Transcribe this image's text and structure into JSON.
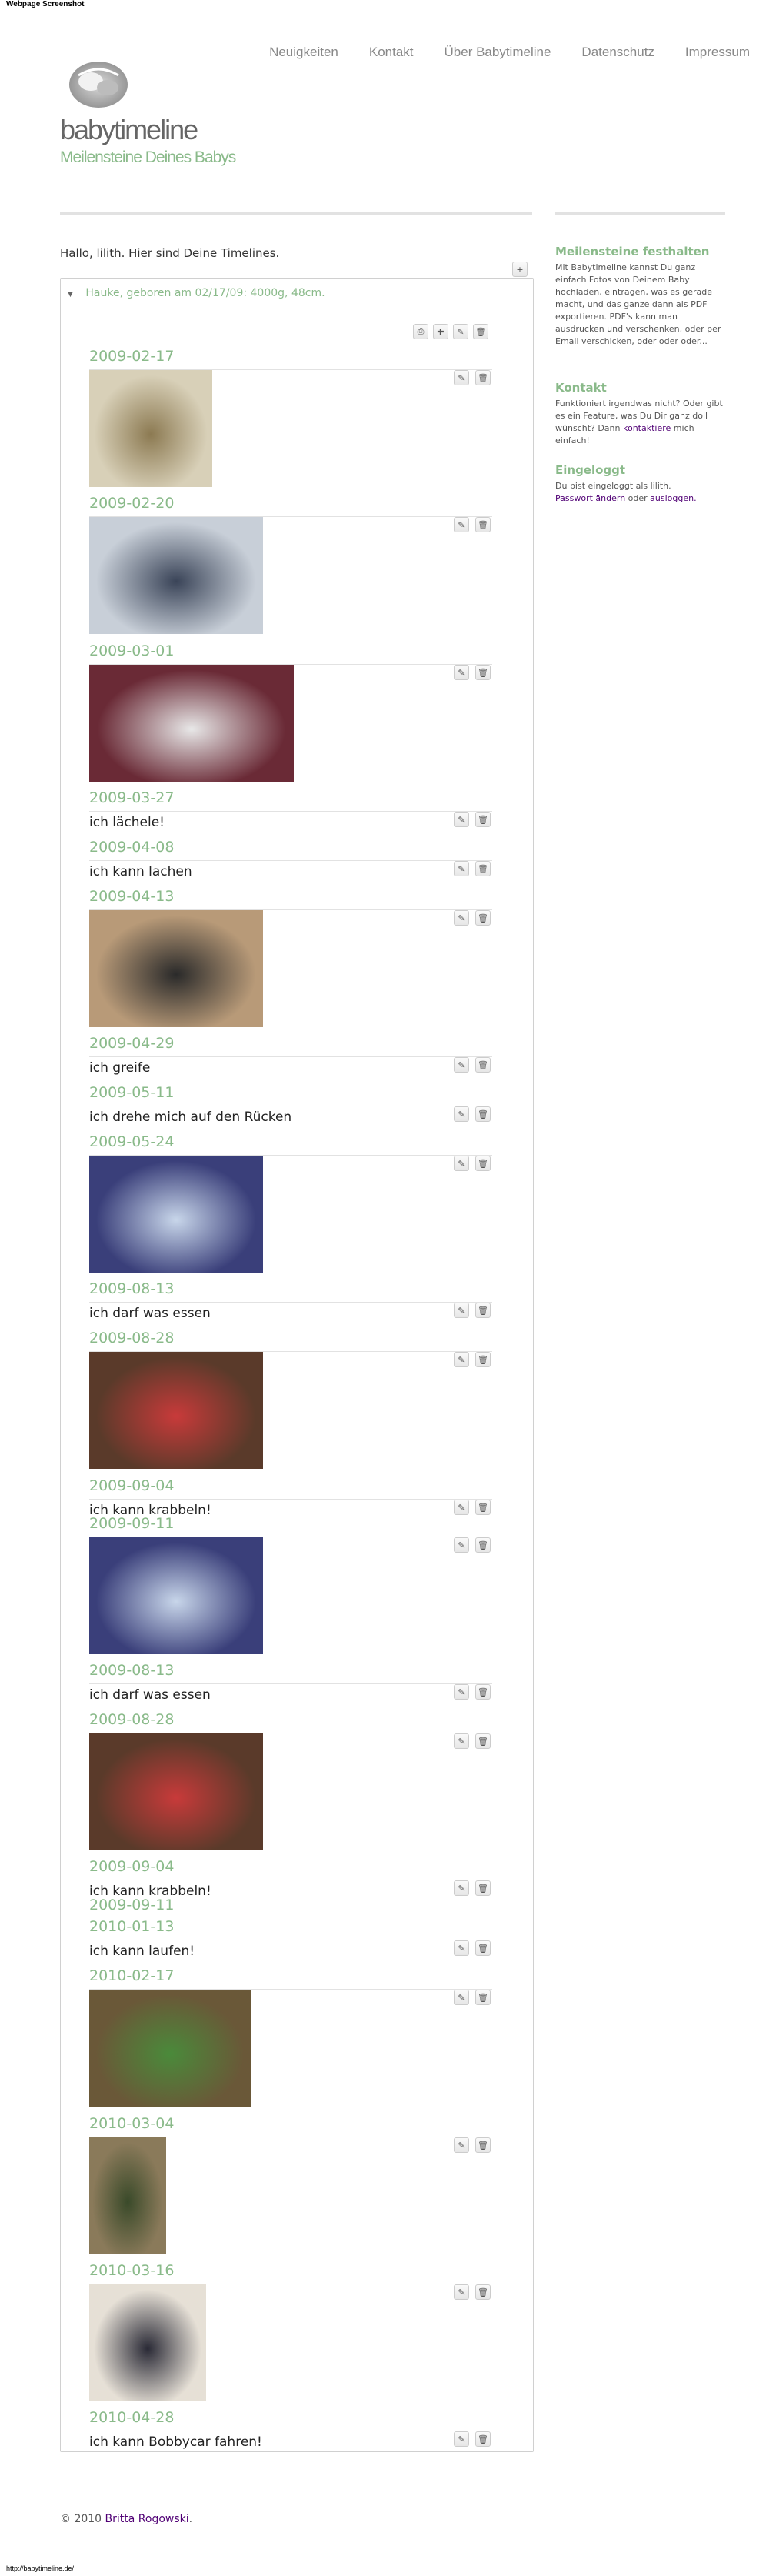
{
  "window": {
    "label": "Webpage Screenshot",
    "status_url": "http://babytimeline.de/"
  },
  "site": {
    "title": "babytimeline",
    "tagline": "Meilensteine Deines Babys"
  },
  "nav": [
    "Neuigkeiten",
    "Kontakt",
    "Über Babytimeline",
    "Datenschutz",
    "Impressum"
  ],
  "greeting": "Hallo, lilith. Hier sind Deine Timelines.",
  "timeline": {
    "header": "Hauke, geboren am 02/17/09: 4000g, 48cm."
  },
  "entries": [
    {
      "date": "2009-02-17",
      "kind": "photo",
      "text": ""
    },
    {
      "date": "2009-02-20",
      "kind": "photo",
      "text": ""
    },
    {
      "date": "2009-03-01",
      "kind": "photo",
      "text": ""
    },
    {
      "date": "2009-03-27",
      "kind": "text",
      "text": "ich lächele!"
    },
    {
      "date": "2009-04-08",
      "kind": "text",
      "text": "ich kann lachen"
    },
    {
      "date": "2009-04-13",
      "kind": "photo",
      "text": ""
    },
    {
      "date": "2009-04-29",
      "kind": "text",
      "text": "ich greife"
    },
    {
      "date": "2009-05-11",
      "kind": "text",
      "text": "ich drehe mich auf den Rücken"
    },
    {
      "date": "2009-05-24",
      "kind": "photo",
      "text": ""
    },
    {
      "date": "2009-08-13",
      "kind": "text",
      "text": "ich darf was essen"
    },
    {
      "date": "2009-08-28",
      "kind": "photo",
      "text": ""
    },
    {
      "date": "2009-09-04",
      "kind": "text",
      "text": "ich kann krabbeln!"
    },
    {
      "date": "2009-09-11",
      "kind": "photo",
      "text": ""
    },
    {
      "date": "2009-08-13",
      "kind": "text",
      "text": "ich darf was essen"
    },
    {
      "date": "2009-08-28",
      "kind": "photo",
      "text": ""
    },
    {
      "date": "2009-09-04",
      "kind": "text",
      "text": "ich kann krabbeln!"
    },
    {
      "date": "2009-09-11",
      "kind": "none",
      "text": ""
    },
    {
      "date": "2010-01-13",
      "kind": "text",
      "text": "ich kann laufen!"
    },
    {
      "date": "2010-02-17",
      "kind": "photo",
      "text": ""
    },
    {
      "date": "2010-03-04",
      "kind": "photo",
      "text": ""
    },
    {
      "date": "2010-03-16",
      "kind": "photo",
      "text": ""
    },
    {
      "date": "2010-04-28",
      "kind": "text",
      "text": "ich kann Bobbycar fahren!"
    }
  ],
  "sidebar": {
    "h1": "Meilensteine festhalten",
    "p1": "Mit Babytimeline kannst Du ganz einfach Fotos von Deinem Baby hochladen, eintragen, was es gerade macht, und das ganze dann als PDF exportieren. PDF's kann man ausdrucken und verschenken, oder per Email verschicken, oder oder oder...",
    "h2": "Kontakt",
    "p2_a": "Funktioniert irgendwas nicht? Oder gibt es ein Feature, was Du Dir ganz doll wünscht? Dann ",
    "p2_link": "kontaktiere",
    "p2_b": " mich einfach!",
    "h3": "Eingeloggt",
    "p3_a": "Du bist eingeloggt als lilith.",
    "p3_link1": "Passwort ändern",
    "p3_mid": " oder ",
    "p3_link2": "ausloggen."
  },
  "footer": {
    "prefix": "© 2010 ",
    "author": "Britta Rogowski",
    "suffix": "."
  },
  "colors": {
    "accent": "#8aba8a",
    "link": "#500075"
  },
  "icons": [
    "print-icon",
    "plus-icon",
    "pencil-icon",
    "trash-icon",
    "expand-arrow-icon"
  ]
}
